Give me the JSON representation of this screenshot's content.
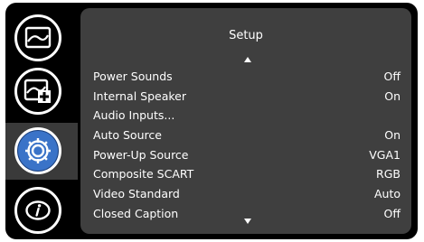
{
  "menu": {
    "title": "Setup",
    "items": [
      {
        "label": "Power Sounds",
        "value": "Off"
      },
      {
        "label": "Internal Speaker",
        "value": "On"
      },
      {
        "label": "Audio Inputs...",
        "value": ""
      },
      {
        "label": "Auto Source",
        "value": "On"
      },
      {
        "label": "Power-Up Source",
        "value": "VGA1"
      },
      {
        "label": "Composite SCART",
        "value": "RGB"
      },
      {
        "label": "Video Standard",
        "value": "Auto"
      },
      {
        "label": "Closed Caption",
        "value": "Off"
      }
    ]
  },
  "rail": {
    "selected": "setup",
    "icons": [
      "picture-icon",
      "picture-settings-icon",
      "setup-gear-icon",
      "information-icon"
    ]
  },
  "colors": {
    "background": "#000000",
    "panel": "#3f3f3f",
    "selected": "#3a73c8",
    "text": "#ffffff"
  }
}
